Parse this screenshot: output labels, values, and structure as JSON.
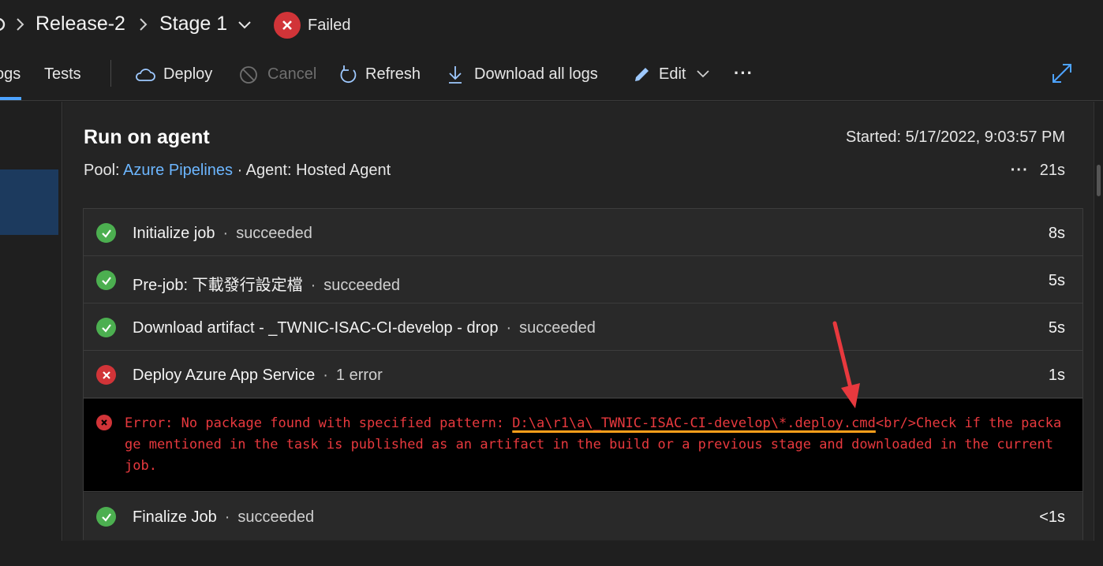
{
  "header": {
    "breadcrumb_release": "Release-2",
    "breadcrumb_stage": "Stage 1",
    "status": "Failed"
  },
  "toolbar": {
    "tab_logs": "ogs",
    "tab_tests": "Tests",
    "deploy": "Deploy",
    "cancel": "Cancel",
    "refresh": "Refresh",
    "download_all_logs": "Download all logs",
    "edit": "Edit",
    "more": "···"
  },
  "job": {
    "title": "Run on agent",
    "started": "Started: 5/17/2022, 9:03:57 PM",
    "pool_label": "Pool: ",
    "pool_name": "Azure Pipelines",
    "agent_text": " · Agent: Hosted Agent",
    "more": "···",
    "duration": "21s"
  },
  "steps": [
    {
      "name": "Initialize job",
      "status": "succeeded",
      "duration": "8s",
      "result": "ok"
    },
    {
      "name": "Pre-job: 下載發行設定檔",
      "status": "succeeded",
      "duration": "5s",
      "result": "ok"
    },
    {
      "name": "Download artifact - _TWNIC-ISAC-CI-develop - drop",
      "status": "succeeded",
      "duration": "5s",
      "result": "ok"
    },
    {
      "name": "Deploy Azure App Service",
      "status": "1 error",
      "duration": "1s",
      "result": "error"
    },
    {
      "name": "Finalize Job",
      "status": "succeeded",
      "duration": "<1s",
      "result": "ok"
    }
  ],
  "error": {
    "prefix": "Error: No package found with specified pattern: ",
    "pattern": "D:\\a\\r1\\a\\_TWNIC-ISAC-CI-develop\\*.deploy.cmd",
    "suffix": "<br/>Check if the package mentioned in the task is published as an artifact in the build or a previous stage and downloaded in the current job."
  },
  "colors": {
    "success": "#4caf50",
    "failure": "#d13438",
    "link": "#6cb6ff",
    "error_text": "#e8393e",
    "annotation_underline": "#ff9f1a",
    "annotation_arrow": "#e8393e"
  }
}
